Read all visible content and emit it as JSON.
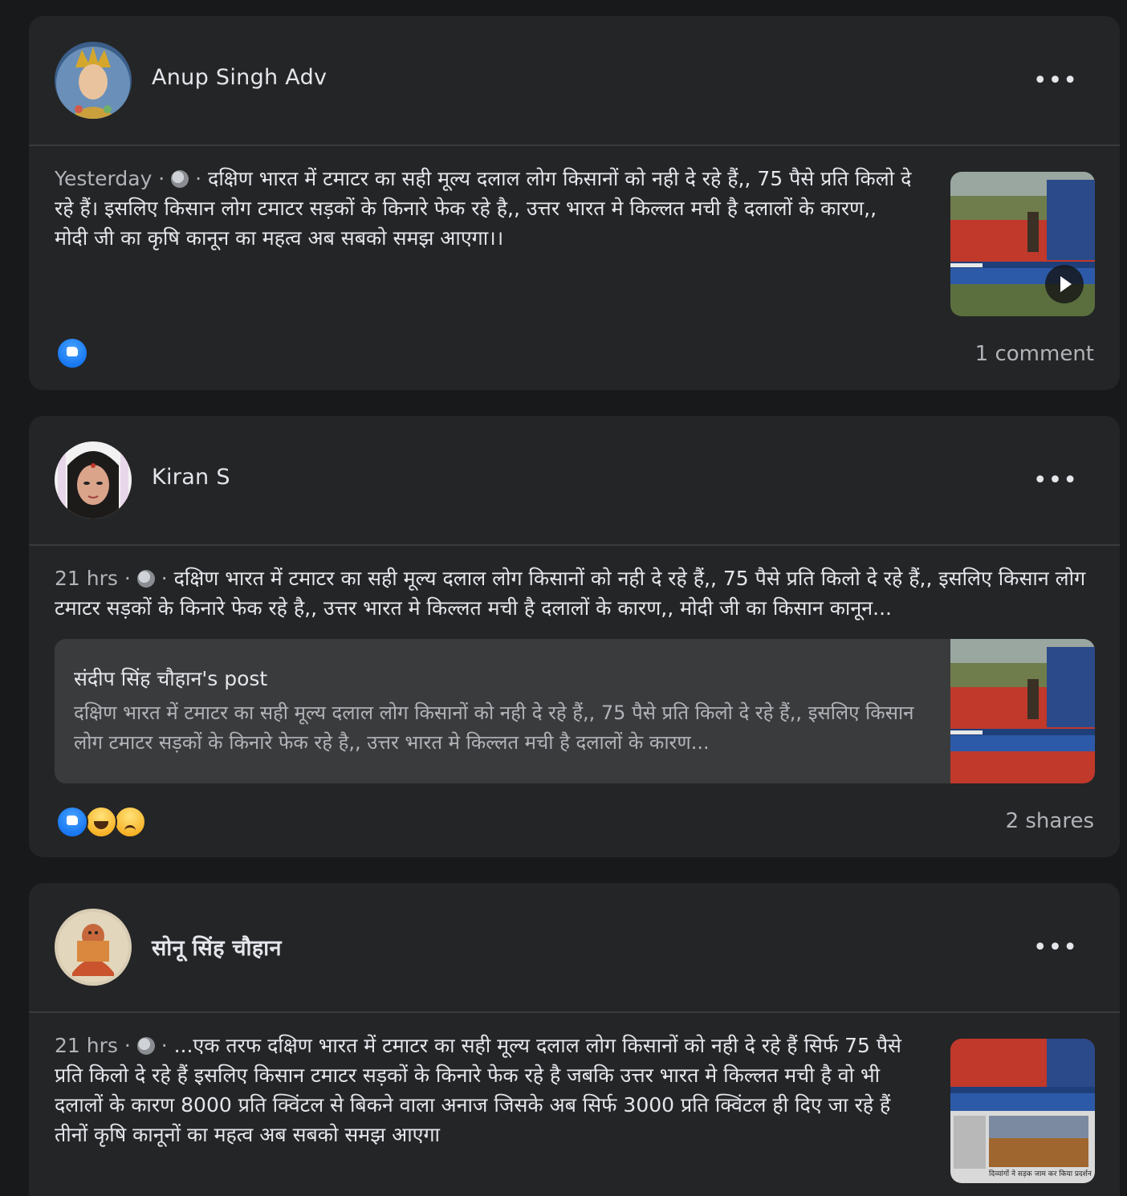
{
  "posts": [
    {
      "author": "Anup Singh Adv",
      "meta": "Yesterday · ",
      "text": "दक्षिण भारत में टमाटर का सही मूल्य दलाल लोग किसानों को नही दे रहे हैं,, 75 पैसे प्रति किलो दे रहे हैं। इसलिए किसान लोग टमाटर सड़कों के किनारे फेक रहे है,, उत्तर भारत मे किल्लत मची है दलालों के कारण,, मोदी जी का कृषि कानून का महत्व अब सबको समझ आएगा।।",
      "stat": "1 comment"
    },
    {
      "author": "Kiran S",
      "meta": "21 hrs · ",
      "text": "दक्षिण भारत में टमाटर का सही मूल्य दलाल लोग किसानों को नही दे रहे हैं,, 75 पैसे प्रति किलो दे रहे हैं,, इसलिए किसान लोग टमाटर सड़कों के किनारे फेक रहे है,, उत्तर भारत मे किल्लत मची है दलालों के कारण,, मोदी जी का किसान कानून...",
      "shared_title": "संदीप सिंह चौहान's post",
      "shared_text": "दक्षिण भारत में टमाटर का सही मूल्य दलाल लोग किसानों को नही दे रहे हैं,, 75 पैसे प्रति किलो दे रहे हैं,, इसलिए किसान लोग टमाटर सड़कों के किनारे फेक रहे है,, उत्तर भारत मे किल्लत मची है दलालों के कारण...",
      "stat": "2 shares"
    },
    {
      "author": "सोनू सिंह चौहान",
      "meta": "21 hrs · ",
      "text": "...एक तरफ दक्षिण भारत में टमाटर का सही मूल्य दलाल लोग किसानों को नही दे रहे हैं सिर्फ 75 पैसे प्रति किलो दे रहे हैं इसलिए किसान टमाटर सड़कों के किनारे फेक रहे है जबकि उत्तर भारत मे किल्लत मची है वो भी दलालों के कारण 8000 प्रति क्विंटल से बिकने वाला अनाज जिसके अब सिर्फ 3000 प्रति क्विंटल ही दिए जा रहे हैं तीनों कृषि कानूनों का महत्व अब सबको समझ आएगा",
      "thumb_caption": "दिव्यांगों ने सड़क जाम कर किया प्रदर्शन"
    }
  ],
  "more_glyph": "•••",
  "icons": {
    "globe": "globe-icon",
    "more": "more-options-icon",
    "like": "like-reaction-icon",
    "haha": "haha-reaction-icon",
    "sad": "sad-reaction-icon",
    "play": "play-icon"
  },
  "colors": {
    "page_bg": "#18191a",
    "card_bg": "#242526",
    "divider": "#3a3b3c",
    "primary_text": "#e4e6eb",
    "secondary_text": "#b0b3b8",
    "like_blue": "#1877f2"
  }
}
